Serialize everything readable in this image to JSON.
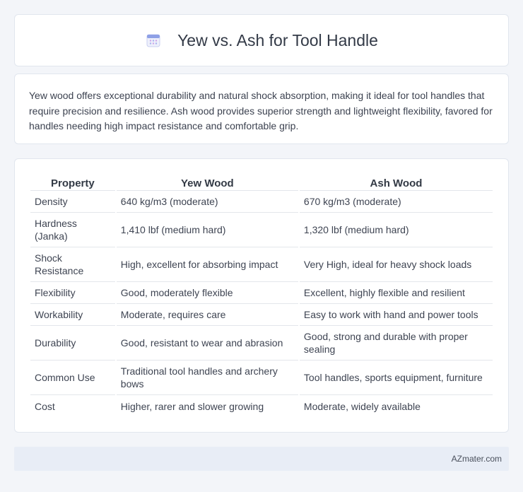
{
  "header": {
    "title": "Yew vs. Ash for Tool Handle",
    "icon": "calendar-icon"
  },
  "intro": {
    "text": "Yew wood offers exceptional durability and natural shock absorption, making it ideal for tool handles that require precision and resilience. Ash wood provides superior strength and lightweight flexibility, favored for handles needing high impact resistance and comfortable grip."
  },
  "table": {
    "headers": [
      "Property",
      "Yew Wood",
      "Ash Wood"
    ],
    "rows": [
      [
        "Density",
        "640 kg/m3 (moderate)",
        "670 kg/m3 (moderate)"
      ],
      [
        "Hardness (Janka)",
        "1,410 lbf (medium hard)",
        "1,320 lbf (medium hard)"
      ],
      [
        "Shock Resistance",
        "High, excellent for absorbing impact",
        "Very High, ideal for heavy shock loads"
      ],
      [
        "Flexibility",
        "Good, moderately flexible",
        "Excellent, highly flexible and resilient"
      ],
      [
        "Workability",
        "Moderate, requires care",
        "Easy to work with hand and power tools"
      ],
      [
        "Durability",
        "Good, resistant to wear and abrasion",
        "Good, strong and durable with proper sealing"
      ],
      [
        "Common Use",
        "Traditional tool handles and archery bows",
        "Tool handles, sports equipment, furniture"
      ],
      [
        "Cost",
        "Higher, rarer and slower growing",
        "Moderate, widely available"
      ]
    ]
  },
  "footer": {
    "text": "AZmater.com"
  },
  "colors": {
    "background": "#f3f5f9",
    "card": "#ffffff",
    "footer_bg": "#e8edf6",
    "icon_accent": "#7b8fe0"
  }
}
